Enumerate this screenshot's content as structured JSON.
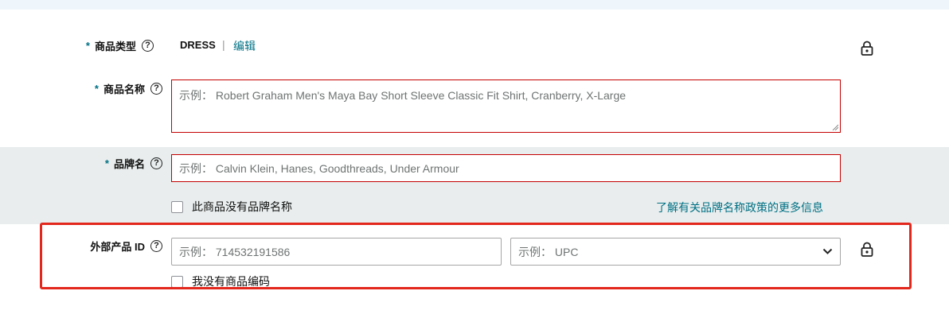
{
  "product_type": {
    "label": "商品类型",
    "required_mark": "*",
    "value": "DRESS",
    "separator": "|",
    "edit_link": "编辑"
  },
  "product_name": {
    "label": "商品名称",
    "required_mark": "*",
    "placeholder": "示例： Robert Graham Men's Maya Bay Short Sleeve Classic Fit Shirt, Cranberry, X-Large"
  },
  "brand_name": {
    "label": "品牌名",
    "required_mark": "*",
    "placeholder": "示例： Calvin Klein, Hanes, Goodthreads, Under Armour",
    "no_brand_checkbox": "此商品没有品牌名称",
    "policy_link": "了解有关品牌名称政策的更多信息"
  },
  "external_id": {
    "label": "外部产品 ID",
    "id_placeholder": "示例： 714532191586",
    "type_select_placeholder": "示例： UPC",
    "no_code_checkbox": "我没有商品编码"
  },
  "help_glyph": "?",
  "icons": {
    "help": "question-circle-icon",
    "lock": "lock-icon",
    "dropdown": "chevron-down-icon"
  },
  "colors": {
    "accent": "#007185",
    "error_border": "#c40000",
    "highlight": "#e3271c",
    "band": "#e9eded"
  }
}
